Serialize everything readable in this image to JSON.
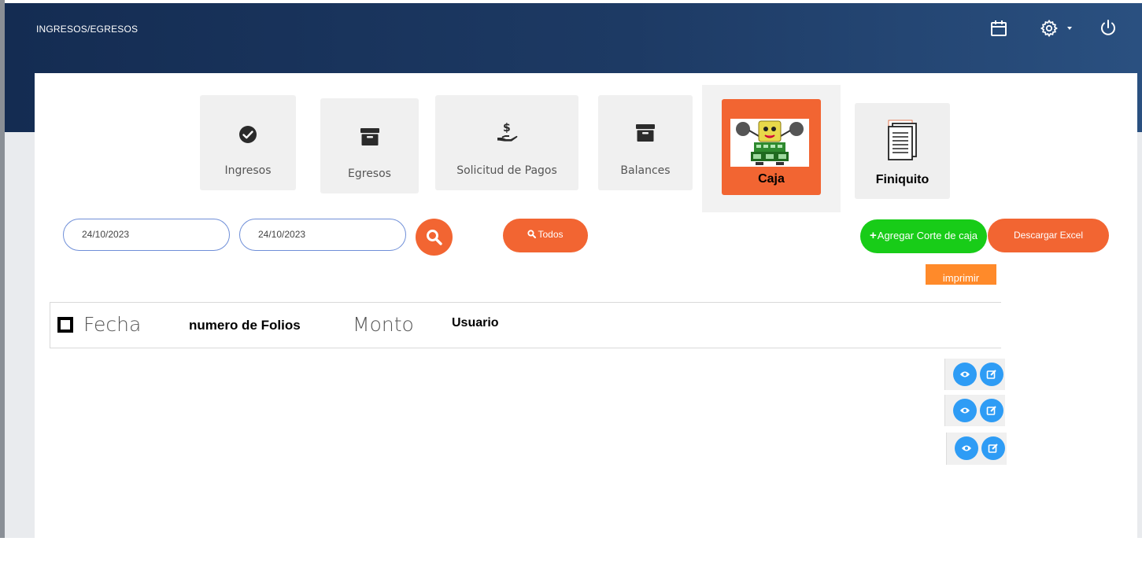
{
  "header": {
    "title": "INGRESOS/EGRESOS",
    "icons": [
      "calendar-icon",
      "gear-icon",
      "power-icon"
    ]
  },
  "tiles": {
    "ingresos": {
      "label": "Ingresos",
      "icon": "check-circle-icon"
    },
    "egresos": {
      "label": "Egresos",
      "icon": "archive-box-icon"
    },
    "solicitud": {
      "label": "Solicitud de Pagos",
      "icon": "hand-dollar-icon"
    },
    "balances": {
      "label": "Balances",
      "icon": "archive-box-icon"
    },
    "caja": {
      "label": "Caja",
      "icon": "cash-register-mascot-icon",
      "active": true
    },
    "finiquito": {
      "label": "Finiquito",
      "icon": "documents-stack-icon"
    }
  },
  "filters": {
    "date_from": "24/10/2023",
    "date_to": "24/10/2023"
  },
  "buttons": {
    "todos": "Todos",
    "agregar_corte": "Agregar Corte de caja",
    "descargar_excel": "Descargar Excel",
    "imprimir": "imprimir"
  },
  "table": {
    "columns": [
      "Fecha",
      "numero de Folios",
      "Monto",
      "Usuario"
    ],
    "rows": [
      {
        "actions": [
          "view",
          "edit"
        ]
      },
      {
        "actions": [
          "view",
          "edit"
        ]
      },
      {
        "actions": [
          "view",
          "edit"
        ]
      }
    ]
  },
  "colors": {
    "header_bg": "#1d3a64",
    "accent_orange": "#f26532",
    "green": "#18cc18",
    "action_blue": "#2e9cf5"
  }
}
